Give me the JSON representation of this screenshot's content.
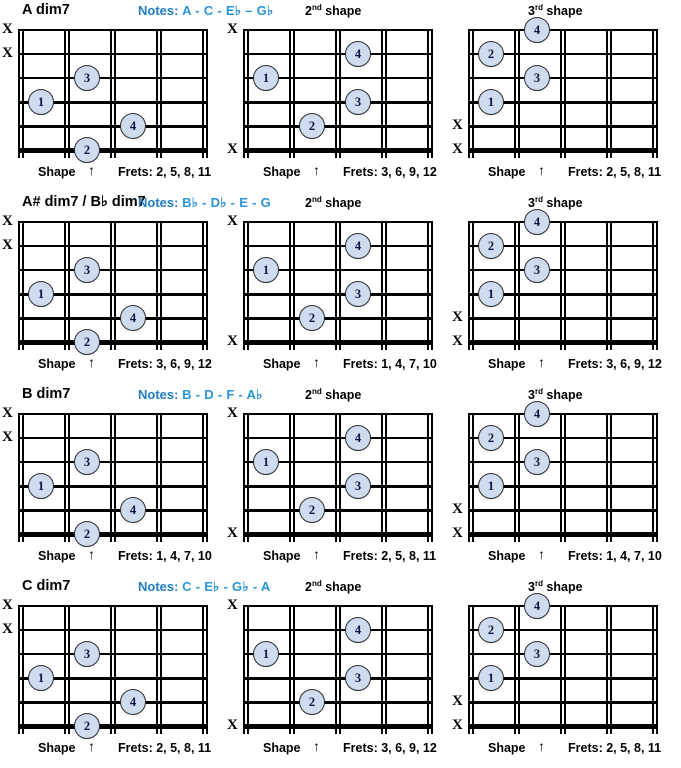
{
  "meta": {
    "accent_blue": "#2a95d8",
    "dot_fill": "#cfdcf0",
    "dot_text": "#121449",
    "line_color": "#000000"
  },
  "labels": {
    "notes_word": "Notes:",
    "shape_word": "Shape",
    "arrow": "↑",
    "frets_word": "Frets:",
    "mute_mark": "X",
    "shape2_caption_num": "2",
    "shape2_caption_sup": "nd",
    "shape3_caption_num": "3",
    "shape3_caption_sup": "rd",
    "shape_caption_tail": " shape"
  },
  "shape_templates": {
    "shape1": {
      "name": "shape-1",
      "mutes": [
        1,
        2
      ],
      "dots": [
        {
          "finger": "3",
          "string": 3,
          "fret": 2
        },
        {
          "finger": "1",
          "string": 4,
          "fret": 1
        },
        {
          "finger": "4",
          "string": 5,
          "fret": 3
        },
        {
          "finger": "2",
          "string": 6,
          "fret": 2
        }
      ]
    },
    "shape2": {
      "name": "shape-2",
      "mutes": [
        1,
        6
      ],
      "dots": [
        {
          "finger": "4",
          "string": 2,
          "fret": 3
        },
        {
          "finger": "1",
          "string": 3,
          "fret": 1
        },
        {
          "finger": "3",
          "string": 4,
          "fret": 3
        },
        {
          "finger": "2",
          "string": 5,
          "fret": 2
        }
      ]
    },
    "shape3": {
      "name": "shape-3",
      "mutes": [
        5,
        6
      ],
      "dots": [
        {
          "finger": "4",
          "string": 1,
          "fret": 2
        },
        {
          "finger": "2",
          "string": 2,
          "fret": 1
        },
        {
          "finger": "3",
          "string": 3,
          "fret": 2
        },
        {
          "finger": "1",
          "string": 4,
          "fret": 1
        }
      ]
    }
  },
  "rows": [
    {
      "chord_name": "A dim7",
      "notes": "A - C - E♭ – G♭",
      "diagrams": [
        {
          "shape": "shape1",
          "frets": "2, 5, 8, 11"
        },
        {
          "shape": "shape2",
          "frets": "3, 6, 9, 12"
        },
        {
          "shape": "shape3",
          "frets": "2, 5, 8, 11"
        }
      ]
    },
    {
      "chord_name": "A# dim7 / B♭ dim7",
      "notes": "B♭ - D♭ - E - G",
      "diagrams": [
        {
          "shape": "shape1",
          "frets": "3, 6, 9, 12"
        },
        {
          "shape": "shape2",
          "frets": "1, 4, 7, 10"
        },
        {
          "shape": "shape3",
          "frets": "3, 6, 9, 12"
        }
      ]
    },
    {
      "chord_name": "B dim7",
      "notes": "B - D - F - A♭",
      "diagrams": [
        {
          "shape": "shape1",
          "frets": "1, 4, 7, 10"
        },
        {
          "shape": "shape2",
          "frets": "2, 5, 8, 11"
        },
        {
          "shape": "shape3",
          "frets": "1, 4, 7, 10"
        }
      ]
    },
    {
      "chord_name": "C dim7",
      "notes": "C - E♭ - G♭ - A",
      "diagrams": [
        {
          "shape": "shape1",
          "frets": "2, 5, 8, 11"
        },
        {
          "shape": "shape2",
          "frets": "3, 6, 9, 12"
        },
        {
          "shape": "shape3",
          "frets": "2, 5, 8, 11"
        }
      ]
    }
  ]
}
